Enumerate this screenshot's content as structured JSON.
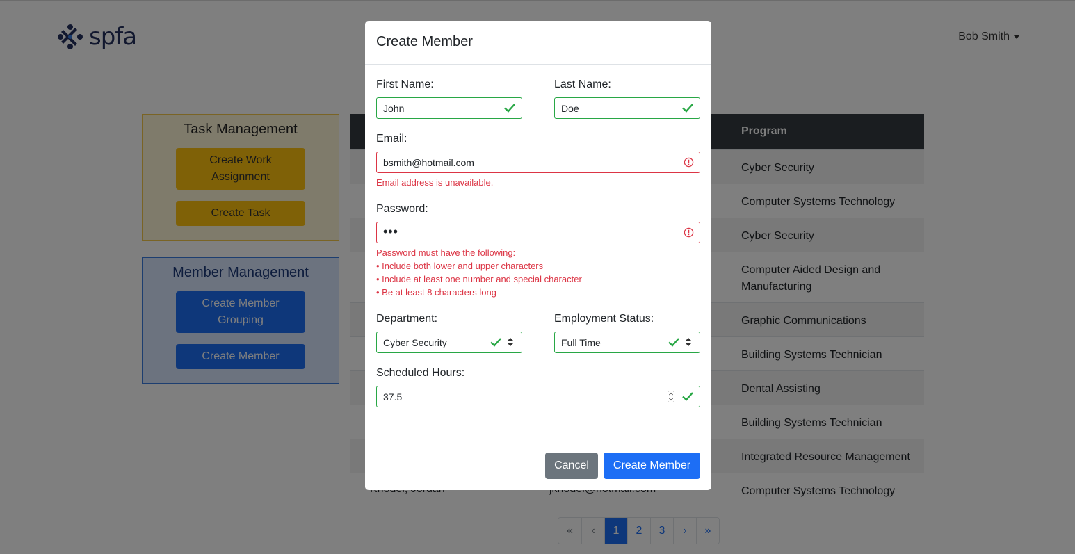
{
  "navbar": {
    "brand": "spfa",
    "user_name": "Bob Smith"
  },
  "task_panel": {
    "title": "Task Management",
    "buttons": [
      "Create Work Assignment",
      "Create Task"
    ]
  },
  "member_panel": {
    "title": "Member Management",
    "buttons": [
      "Create Member Grouping",
      "Create Member"
    ]
  },
  "table": {
    "header_program": "Program",
    "rows": [
      {
        "program": "Cyber Security"
      },
      {
        "program": "Computer Systems Technology"
      },
      {
        "program": "Cyber Security"
      },
      {
        "program": "Computer Aided Design and Manufacturing"
      },
      {
        "program": "Graphic Communications"
      },
      {
        "program": "Building Systems Technician"
      },
      {
        "program": "Dental Assisting"
      },
      {
        "program": "Building Systems Technician"
      },
      {
        "program": "Integrated Resource Management"
      },
      {
        "name": "Knodel, Jordan",
        "email": "jknodel@hotmail.com",
        "program": "Computer Systems Technology"
      }
    ]
  },
  "pagination": {
    "first": "«",
    "prev": "‹",
    "pages": [
      "1",
      "2",
      "3"
    ],
    "active_page": "1",
    "next": "›",
    "last": "»"
  },
  "modal": {
    "title": "Create Member",
    "first_name_label": "First Name:",
    "first_name_value": "John",
    "last_name_label": "Last Name:",
    "last_name_value": "Doe",
    "email_label": "Email:",
    "email_value": "bsmith@hotmail.com",
    "email_error": "Email address is unavailable.",
    "password_label": "Password:",
    "password_value": "•••",
    "password_errors": [
      "Password must have the following:",
      "• Include both lower and upper characters",
      "• Include at least one number and special character",
      "• Be at least 8 characters long"
    ],
    "department_label": "Department:",
    "department_value": "Cyber Security",
    "employment_label": "Employment Status:",
    "employment_value": "Full Time",
    "hours_label": "Scheduled Hours:",
    "hours_value": "37.5",
    "cancel_label": "Cancel",
    "create_label": "Create Member"
  },
  "colors": {
    "valid": "#28a745",
    "invalid": "#dc3545",
    "primary": "#1d6ef5",
    "secondary": "#6c757d",
    "warning": "#ffc20e"
  },
  "icons": [
    "spfa-logo-icon",
    "check-icon",
    "error-circle-icon",
    "select-arrows-icon",
    "number-spinner-icon",
    "caret-down-icon"
  ]
}
